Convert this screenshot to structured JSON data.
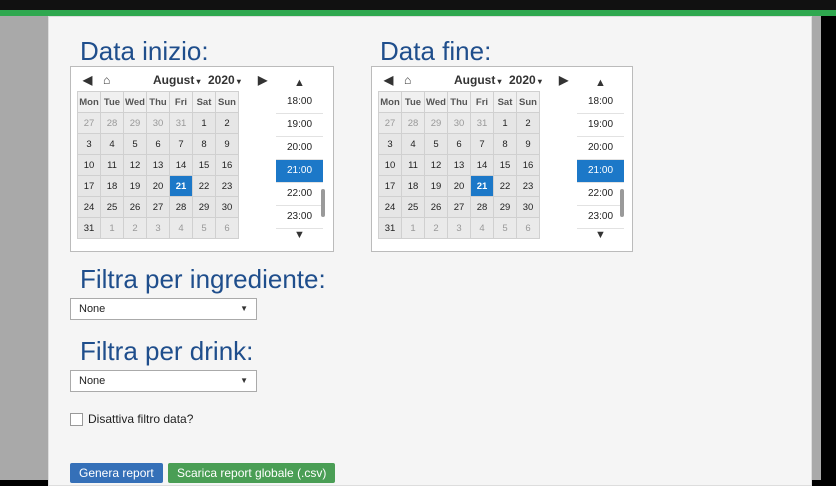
{
  "start": {
    "title": "Data inizio:",
    "month": "August",
    "year": "2020",
    "weekdays": [
      "Mon",
      "Tue",
      "Wed",
      "Thu",
      "Fri",
      "Sat",
      "Sun"
    ],
    "weeks": [
      [
        "27",
        "28",
        "29",
        "30",
        "31",
        "1",
        "2"
      ],
      [
        "3",
        "4",
        "5",
        "6",
        "7",
        "8",
        "9"
      ],
      [
        "10",
        "11",
        "12",
        "13",
        "14",
        "15",
        "16"
      ],
      [
        "17",
        "18",
        "19",
        "20",
        "21",
        "22",
        "23"
      ],
      [
        "24",
        "25",
        "26",
        "27",
        "28",
        "29",
        "30"
      ],
      [
        "31",
        "1",
        "2",
        "3",
        "4",
        "5",
        "6"
      ]
    ],
    "times": [
      "18:00",
      "19:00",
      "20:00",
      "21:00",
      "22:00",
      "23:00"
    ]
  },
  "end": {
    "title": "Data fine:",
    "month": "August",
    "year": "2020",
    "weekdays": [
      "Mon",
      "Tue",
      "Wed",
      "Thu",
      "Fri",
      "Sat",
      "Sun"
    ],
    "weeks": [
      [
        "27",
        "28",
        "29",
        "30",
        "31",
        "1",
        "2"
      ],
      [
        "3",
        "4",
        "5",
        "6",
        "7",
        "8",
        "9"
      ],
      [
        "10",
        "11",
        "12",
        "13",
        "14",
        "15",
        "16"
      ],
      [
        "17",
        "18",
        "19",
        "20",
        "21",
        "22",
        "23"
      ],
      [
        "24",
        "25",
        "26",
        "27",
        "28",
        "29",
        "30"
      ],
      [
        "31",
        "1",
        "2",
        "3",
        "4",
        "5",
        "6"
      ]
    ],
    "times": [
      "18:00",
      "19:00",
      "20:00",
      "21:00",
      "22:00",
      "23:00"
    ]
  },
  "selected_day": "21",
  "selected_time": "21:00",
  "ingredient": {
    "title": "Filtra per ingrediente:",
    "value": "None"
  },
  "drink": {
    "title": "Filtra per drink:",
    "value": "None"
  },
  "disable_date_filter": {
    "label": "Disattiva filtro data?",
    "checked": false
  },
  "buttons": {
    "generate": "Genera report",
    "download": "Scarica report globale (.csv)"
  },
  "colors": {
    "accent": "#1c78c8",
    "title": "#1f4e8c",
    "success": "#4a9e55",
    "primary": "#3570b8",
    "topline": "#2fa84f"
  },
  "icons": [
    "prev-month-icon",
    "home-icon",
    "next-month-icon",
    "scroll-up-icon",
    "scroll-down-icon",
    "dropdown-caret-icon"
  ]
}
